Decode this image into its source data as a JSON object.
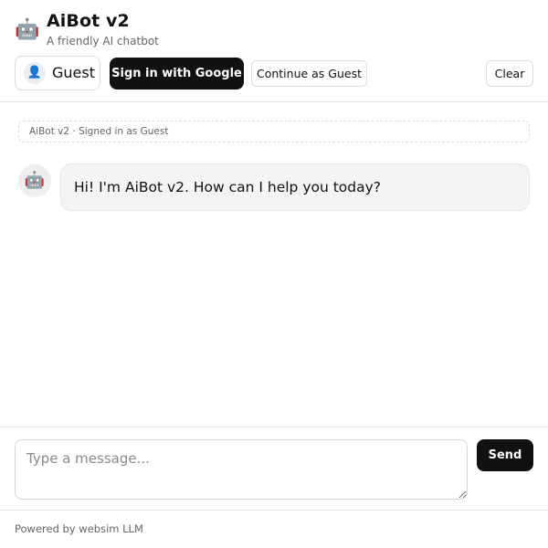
{
  "app": {
    "icon": "robot-icon",
    "title": "AiBot v2",
    "subtitle": "A friendly AI chatbot"
  },
  "user": {
    "avatar_icon": "user-icon",
    "name": "Guest"
  },
  "auth": {
    "google_label": "Sign in with Google",
    "guest_label": "Continue as Guest"
  },
  "toolbar": {
    "clear_label": "Clear"
  },
  "chat": {
    "system_note": "AiBot v2 · Signed in as Guest",
    "messages": [
      {
        "role": "bot",
        "avatar_icon": "robot-icon",
        "text": "Hi! I'm AiBot v2. How can I help you today?"
      }
    ]
  },
  "composer": {
    "placeholder": "Type a message...",
    "value": "",
    "send_label": "Send"
  },
  "footer": {
    "text": "Powered by websim LLM"
  },
  "colors": {
    "primary_button": "#111111",
    "bubble_bg": "#f4f4f4",
    "border": "#e5e5e5"
  }
}
